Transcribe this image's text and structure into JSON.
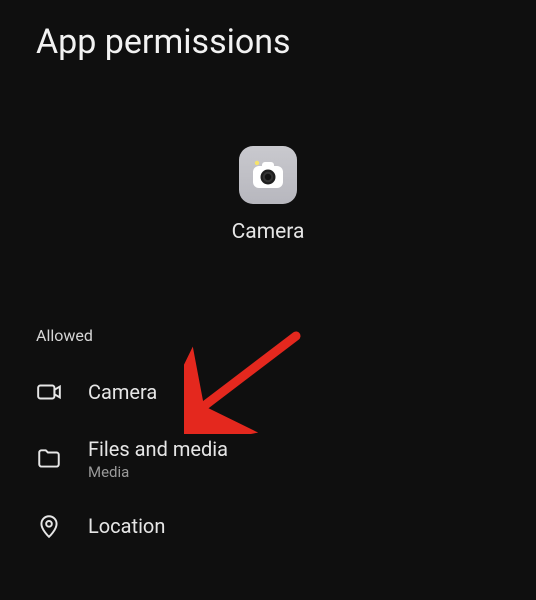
{
  "page": {
    "title": "App permissions"
  },
  "app": {
    "name": "Camera"
  },
  "sections": {
    "allowed_header": "Allowed"
  },
  "permissions": [
    {
      "label": "Camera",
      "sub": ""
    },
    {
      "label": "Files and media",
      "sub": "Media"
    },
    {
      "label": "Location",
      "sub": ""
    }
  ],
  "colors": {
    "annotation_arrow": "#e4281e"
  }
}
